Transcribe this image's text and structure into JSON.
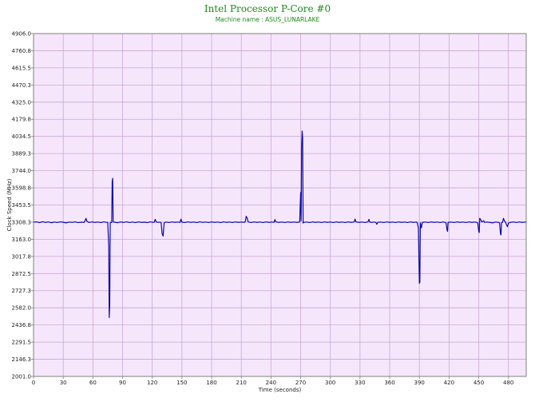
{
  "chart_data": {
    "type": "line",
    "title": "Intel Processor P-Core #0",
    "subtitle": "Machine name : ASUS_LUNARLAKE",
    "xlabel": "Time (seconds)",
    "ylabel": "Clock Speed (MHz)",
    "xlim": [
      0,
      498
    ],
    "ylim": [
      2001.0,
      4906.0
    ],
    "x_ticks": [
      "0",
      "30",
      "60",
      "90",
      "120",
      "150",
      "180",
      "210",
      "240",
      "270",
      "300",
      "330",
      "360",
      "390",
      "420",
      "450",
      "480"
    ],
    "y_ticks": [
      "2001.0",
      "2146.3",
      "2291.5",
      "2436.8",
      "2582.0",
      "2727.3",
      "2872.5",
      "3017.8",
      "3163.0",
      "3308.3",
      "3453.5",
      "3598.8",
      "3744.0",
      "3889.3",
      "4034.5",
      "4179.8",
      "4325.0",
      "4470.3",
      "4615.5",
      "4760.8",
      "4906.0"
    ],
    "grid": true,
    "colors": {
      "background": "#f6e6fb",
      "grid": "#c8a8d8",
      "line": "#0a0aa8",
      "title": "#1f8a1f"
    },
    "baseline": 3308.3,
    "series": [
      {
        "points": [
          [
            0,
            3308
          ],
          [
            3,
            3311
          ],
          [
            6,
            3304
          ],
          [
            9,
            3312
          ],
          [
            12,
            3306
          ],
          [
            15,
            3310
          ],
          [
            18,
            3303
          ],
          [
            21,
            3309
          ],
          [
            24,
            3305
          ],
          [
            27,
            3311
          ],
          [
            30,
            3307
          ],
          [
            33,
            3302
          ],
          [
            36,
            3309
          ],
          [
            39,
            3306
          ],
          [
            42,
            3311
          ],
          [
            45,
            3304
          ],
          [
            48,
            3308
          ],
          [
            51,
            3306
          ],
          [
            52,
            3318
          ],
          [
            53,
            3340
          ],
          [
            54,
            3316
          ],
          [
            56,
            3305
          ],
          [
            59,
            3310
          ],
          [
            62,
            3306
          ],
          [
            65,
            3309
          ],
          [
            68,
            3304
          ],
          [
            71,
            3311
          ],
          [
            74,
            3306
          ],
          [
            75,
            3305
          ],
          [
            76,
            3110
          ],
          [
            76.5,
            2500
          ],
          [
            77,
            2600
          ],
          [
            77.5,
            3300
          ],
          [
            78,
            3306
          ],
          [
            79,
            3305
          ],
          [
            79.5,
            3650
          ],
          [
            80,
            3680
          ],
          [
            80.5,
            3310
          ],
          [
            82,
            3308
          ],
          [
            85,
            3303
          ],
          [
            88,
            3310
          ],
          [
            91,
            3306
          ],
          [
            94,
            3311
          ],
          [
            97,
            3305
          ],
          [
            100,
            3309
          ],
          [
            103,
            3304
          ],
          [
            106,
            3310
          ],
          [
            109,
            3306
          ],
          [
            112,
            3308
          ],
          [
            115,
            3304
          ],
          [
            118,
            3311
          ],
          [
            121,
            3306
          ],
          [
            122,
            3308
          ],
          [
            123,
            3332
          ],
          [
            124,
            3310
          ],
          [
            126,
            3306
          ],
          [
            128,
            3309
          ],
          [
            129,
            3300
          ],
          [
            130,
            3210
          ],
          [
            131,
            3190
          ],
          [
            132,
            3302
          ],
          [
            134,
            3309
          ],
          [
            137,
            3305
          ],
          [
            140,
            3310
          ],
          [
            143,
            3306
          ],
          [
            146,
            3309
          ],
          [
            148,
            3306
          ],
          [
            149,
            3333
          ],
          [
            150,
            3308
          ],
          [
            153,
            3305
          ],
          [
            156,
            3311
          ],
          [
            159,
            3306
          ],
          [
            162,
            3309
          ],
          [
            165,
            3304
          ],
          [
            168,
            3311
          ],
          [
            171,
            3306
          ],
          [
            174,
            3309
          ],
          [
            177,
            3305
          ],
          [
            180,
            3310
          ],
          [
            183,
            3306
          ],
          [
            186,
            3309
          ],
          [
            189,
            3304
          ],
          [
            192,
            3311
          ],
          [
            195,
            3306
          ],
          [
            198,
            3309
          ],
          [
            201,
            3305
          ],
          [
            204,
            3310
          ],
          [
            207,
            3306
          ],
          [
            210,
            3309
          ],
          [
            213,
            3306
          ],
          [
            214,
            3312
          ],
          [
            215,
            3358
          ],
          [
            216,
            3340
          ],
          [
            217,
            3310
          ],
          [
            220,
            3305
          ],
          [
            223,
            3310
          ],
          [
            226,
            3306
          ],
          [
            229,
            3309
          ],
          [
            232,
            3305
          ],
          [
            235,
            3310
          ],
          [
            238,
            3306
          ],
          [
            241,
            3309
          ],
          [
            243,
            3306
          ],
          [
            244,
            3330
          ],
          [
            245,
            3310
          ],
          [
            248,
            3306
          ],
          [
            251,
            3309
          ],
          [
            254,
            3305
          ],
          [
            257,
            3310
          ],
          [
            260,
            3306
          ],
          [
            263,
            3309
          ],
          [
            266,
            3306
          ],
          [
            268,
            3308
          ],
          [
            269,
            3310
          ],
          [
            270,
            3560
          ],
          [
            270.5,
            3320
          ],
          [
            271,
            3950
          ],
          [
            271.5,
            4080
          ],
          [
            272,
            4020
          ],
          [
            272.5,
            3300
          ],
          [
            273,
            3306
          ],
          [
            276,
            3309
          ],
          [
            279,
            3305
          ],
          [
            282,
            3310
          ],
          [
            285,
            3306
          ],
          [
            288,
            3309
          ],
          [
            291,
            3305
          ],
          [
            294,
            3310
          ],
          [
            297,
            3306
          ],
          [
            300,
            3309
          ],
          [
            303,
            3305
          ],
          [
            306,
            3310
          ],
          [
            309,
            3306
          ],
          [
            312,
            3309
          ],
          [
            315,
            3305
          ],
          [
            318,
            3310
          ],
          [
            321,
            3306
          ],
          [
            324,
            3309
          ],
          [
            325,
            3334
          ],
          [
            326,
            3310
          ],
          [
            329,
            3306
          ],
          [
            332,
            3309
          ],
          [
            335,
            3305
          ],
          [
            338,
            3310
          ],
          [
            339,
            3332
          ],
          [
            340,
            3308
          ],
          [
            342,
            3306
          ],
          [
            344,
            3309
          ],
          [
            346,
            3306
          ],
          [
            347,
            3290
          ],
          [
            348,
            3306
          ],
          [
            351,
            3309
          ],
          [
            354,
            3305
          ],
          [
            357,
            3310
          ],
          [
            360,
            3306
          ],
          [
            363,
            3309
          ],
          [
            366,
            3305
          ],
          [
            369,
            3310
          ],
          [
            372,
            3306
          ],
          [
            375,
            3309
          ],
          [
            378,
            3305
          ],
          [
            381,
            3310
          ],
          [
            384,
            3306
          ],
          [
            387,
            3309
          ],
          [
            388,
            3300
          ],
          [
            389,
            3260
          ],
          [
            390,
            2790
          ],
          [
            390.5,
            2800
          ],
          [
            391,
            3302
          ],
          [
            392,
            3260
          ],
          [
            393,
            3306
          ],
          [
            396,
            3309
          ],
          [
            399,
            3305
          ],
          [
            402,
            3310
          ],
          [
            405,
            3306
          ],
          [
            408,
            3309
          ],
          [
            411,
            3305
          ],
          [
            414,
            3310
          ],
          [
            416,
            3306
          ],
          [
            417,
            3300
          ],
          [
            418,
            3240
          ],
          [
            418.5,
            3230
          ],
          [
            419,
            3306
          ],
          [
            422,
            3309
          ],
          [
            425,
            3305
          ],
          [
            428,
            3310
          ],
          [
            431,
            3306
          ],
          [
            434,
            3309
          ],
          [
            437,
            3305
          ],
          [
            440,
            3310
          ],
          [
            443,
            3306
          ],
          [
            446,
            3309
          ],
          [
            448,
            3306
          ],
          [
            449,
            3302
          ],
          [
            450,
            3230
          ],
          [
            450.5,
            3220
          ],
          [
            451,
            3340
          ],
          [
            452,
            3330
          ],
          [
            453,
            3310
          ],
          [
            455,
            3320
          ],
          [
            456,
            3306
          ],
          [
            458,
            3309
          ],
          [
            461,
            3306
          ],
          [
            464,
            3302
          ],
          [
            467,
            3309
          ],
          [
            470,
            3306
          ],
          [
            471,
            3302
          ],
          [
            472,
            3210
          ],
          [
            472.5,
            3200
          ],
          [
            473,
            3304
          ],
          [
            474,
            3306
          ],
          [
            475,
            3340
          ],
          [
            476,
            3318
          ],
          [
            477,
            3308
          ],
          [
            479,
            3270
          ],
          [
            480,
            3300
          ],
          [
            482,
            3306
          ],
          [
            485,
            3310
          ],
          [
            488,
            3305
          ],
          [
            491,
            3310
          ],
          [
            494,
            3306
          ],
          [
            497,
            3309
          ],
          [
            498,
            3306
          ]
        ]
      }
    ]
  }
}
